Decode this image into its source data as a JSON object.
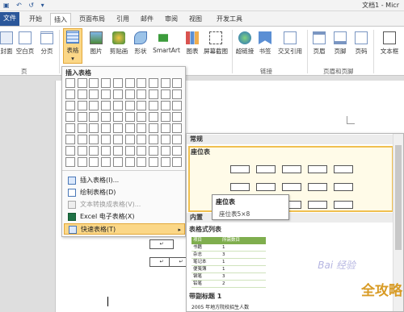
{
  "window": {
    "quick_access": "▣ ↶ ↺ ▾",
    "title": "文档1 - Micr"
  },
  "tabs": [
    "文件",
    "开始",
    "插入",
    "页面布局",
    "引用",
    "邮件",
    "审阅",
    "视图",
    "开发工具"
  ],
  "ribbon": {
    "buttons": [
      "封面",
      "空白页",
      "分页",
      "表格",
      "图片",
      "剪贴画",
      "形状",
      "SmartArt",
      "图表",
      "屏幕截图",
      "超链接",
      "书签",
      "交叉引用",
      "页眉",
      "页脚",
      "页码",
      "文本框"
    ],
    "dropdown_marker": "▾",
    "groups": [
      "页",
      "链接",
      "页眉和页脚"
    ]
  },
  "table_menu": {
    "header": "插入表格",
    "items": [
      {
        "label": "插入表格(I)...",
        "disabled": false
      },
      {
        "label": "绘制表格(D)",
        "disabled": false
      },
      {
        "label": "文本转换成表格(V)...",
        "disabled": true
      },
      {
        "label": "Excel 电子表格(X)",
        "disabled": false
      },
      {
        "label": "快速表格(T)",
        "disabled": false,
        "selected": true
      }
    ],
    "submenu_arrow": "▸"
  },
  "quick_tables": {
    "section_builtin": "常规",
    "first_label": "座位表",
    "section2": "内置",
    "label2": "表格式列表",
    "label3": "带副标题 1",
    "label3_sub": "2005 年地方院校招生人数",
    "mini_table": {
      "header": [
        "项目",
        "所需数目"
      ],
      "rows": [
        [
          "书籍",
          "1"
        ],
        [
          "杂志",
          "3"
        ],
        [
          "笔记本",
          "1"
        ],
        [
          "便笺簿",
          "1"
        ],
        [
          "钢笔",
          "3"
        ],
        [
          "铅笔",
          "2"
        ]
      ]
    }
  },
  "tooltip": {
    "title": "座位表",
    "desc": "座位表5×8"
  },
  "document": {
    "cell_mark": "↵"
  },
  "watermark": "全攻略",
  "baidu": "Bai 经验"
}
